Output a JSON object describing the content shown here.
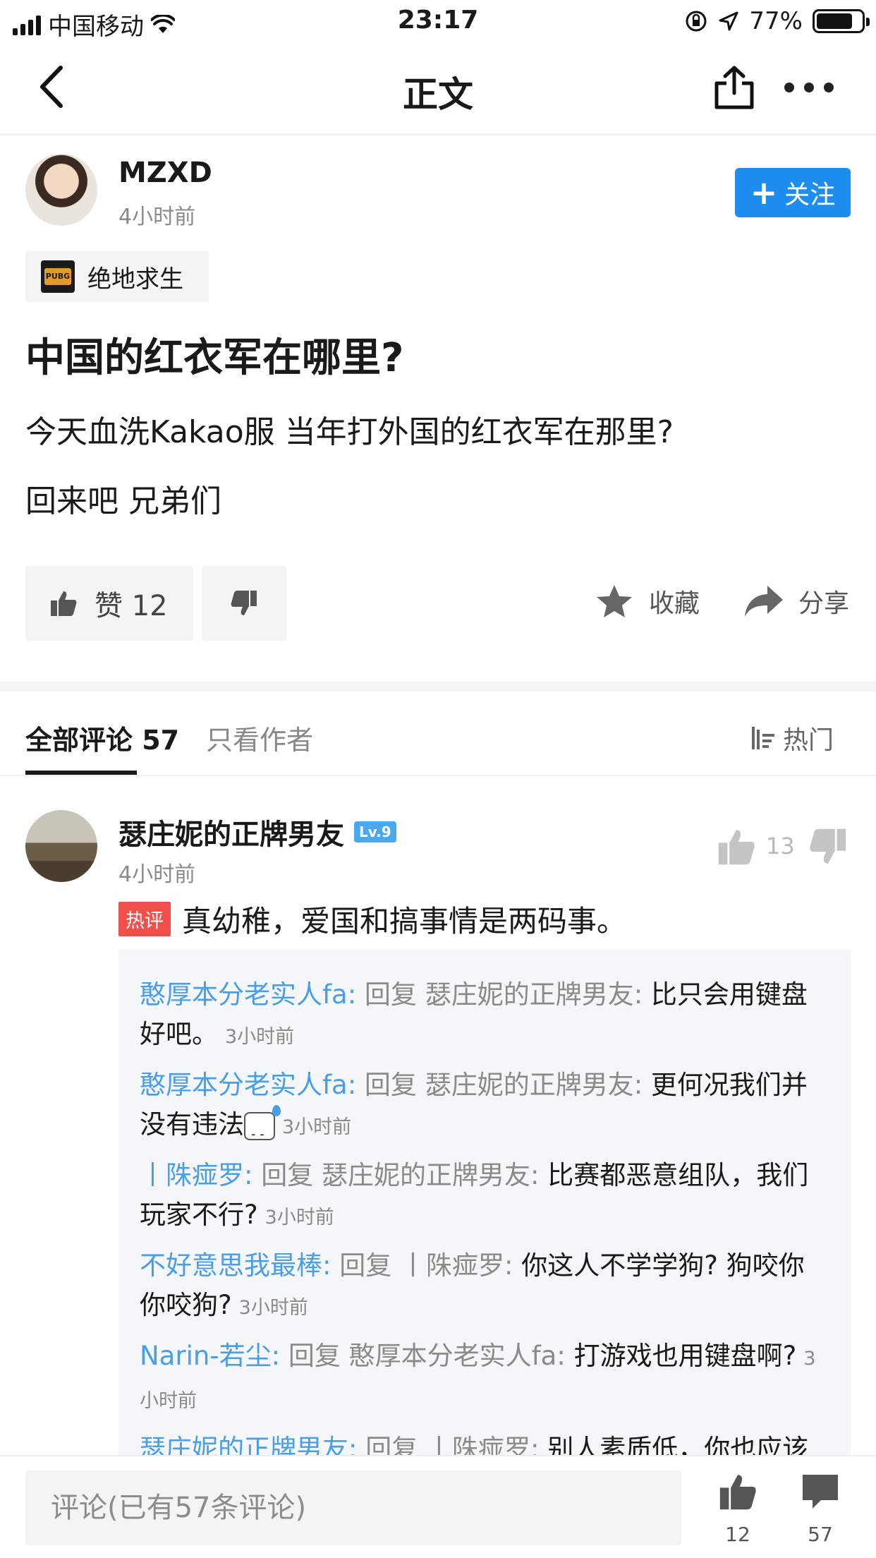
{
  "status_bar": {
    "carrier": "中国移动",
    "time": "23:17",
    "battery": "77%"
  },
  "nav": {
    "title": "正文"
  },
  "post": {
    "author": "MZXD",
    "time": "4小时前",
    "follow_label": "关注",
    "game_tag": "绝地求生",
    "game_logo_text": "PUBG",
    "title": "中国的红衣军在哪里?",
    "paragraphs": [
      "今天血洗Kakao服 当年打外国的红衣军在那里?",
      "回来吧 兄弟们"
    ],
    "like_label": "赞 12",
    "favorite_label": "收藏",
    "share_label": "分享"
  },
  "tabs": {
    "all_label": "全部评论 57",
    "author_only_label": "只看作者",
    "sort_label": "热门"
  },
  "comment": {
    "user": "瑟庄妮的正牌男友",
    "level": "Lv.9",
    "time": "4小时前",
    "like_count": "13",
    "hot_label": "热评",
    "text": "真幼稚，爱国和搞事情是两码事。",
    "replies": [
      {
        "user": "憨厚本分老实人fa:",
        "mid": " 回复 瑟庄妮的正牌男友:",
        "text": " 比只会用键盘好吧。",
        "time": "3小时前"
      },
      {
        "user": "憨厚本分老实人fa:",
        "mid": " 回复 瑟庄妮的正牌男友:",
        "text": " 更何况我们并没有违法",
        "emoji": "sweat-emoji",
        "time": "3小时前"
      },
      {
        "user": "丨陎痖罗:",
        "mid": " 回复 瑟庄妮的正牌男友:",
        "text": " 比赛都恶意组队，我们玩家不行?",
        "time": "3小时前"
      },
      {
        "user": "不好意思我最棒:",
        "mid": " 回复 丨陎痖罗:",
        "text": " 你这人不学学狗? 狗咬你你咬狗?",
        "time": "3小时前"
      },
      {
        "user": "Narin-若尘:",
        "mid": " 回复 憨厚本分老实人fa:",
        "text": " 打游戏也用键盘啊?",
        "time": "3小时前"
      },
      {
        "user": "瑟庄妮的正牌男友:",
        "mid": " 回复 丨陎痖罗:",
        "text": " 别人素质低，你也应该低?",
        "time": ""
      }
    ]
  },
  "bottom_bar": {
    "comment_placeholder": "评论(已有57条评论)",
    "like_count": "12",
    "comment_count": "57"
  },
  "colors": {
    "accent": "#1e8df0",
    "reply_user": "#4a9ee8",
    "hot_badge": "#f0504a"
  }
}
